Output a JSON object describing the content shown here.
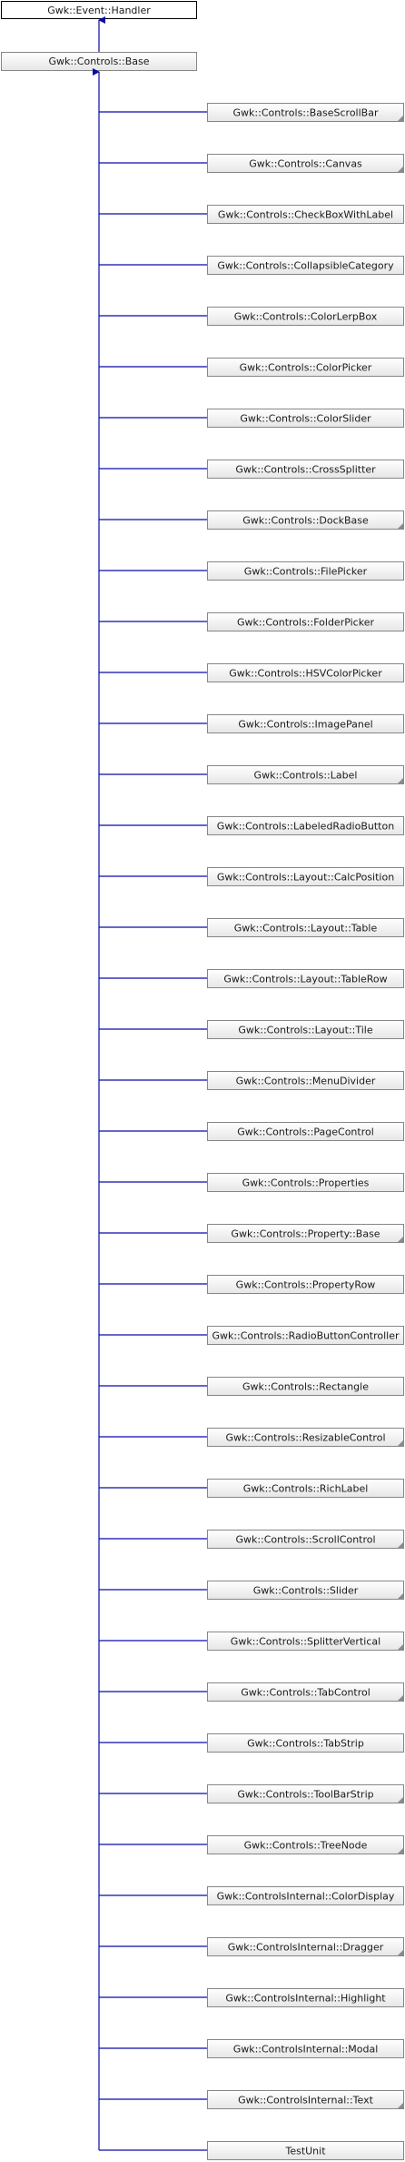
{
  "diagram": {
    "root": {
      "label": "Gwk::Event::Handler"
    },
    "base": {
      "label": "Gwk::Controls::Base"
    },
    "children": [
      "Gwk::Controls::BaseScrollBar",
      "Gwk::Controls::Canvas",
      "Gwk::Controls::CheckBoxWithLabel",
      "Gwk::Controls::CollapsibleCategory",
      "Gwk::Controls::ColorLerpBox",
      "Gwk::Controls::ColorPicker",
      "Gwk::Controls::ColorSlider",
      "Gwk::Controls::CrossSplitter",
      "Gwk::Controls::DockBase",
      "Gwk::Controls::FilePicker",
      "Gwk::Controls::FolderPicker",
      "Gwk::Controls::HSVColorPicker",
      "Gwk::Controls::ImagePanel",
      "Gwk::Controls::Label",
      "Gwk::Controls::LabeledRadioButton",
      "Gwk::Controls::Layout::CalcPosition",
      "Gwk::Controls::Layout::Table",
      "Gwk::Controls::Layout::TableRow",
      "Gwk::Controls::Layout::Tile",
      "Gwk::Controls::MenuDivider",
      "Gwk::Controls::PageControl",
      "Gwk::Controls::Properties",
      "Gwk::Controls::Property::Base",
      "Gwk::Controls::PropertyRow",
      "Gwk::Controls::RadioButtonController",
      "Gwk::Controls::Rectangle",
      "Gwk::Controls::ResizableControl",
      "Gwk::Controls::RichLabel",
      "Gwk::Controls::ScrollControl",
      "Gwk::Controls::Slider",
      "Gwk::Controls::SplitterVertical",
      "Gwk::Controls::TabControl",
      "Gwk::Controls::TabStrip",
      "Gwk::Controls::ToolBarStrip",
      "Gwk::Controls::TreeNode",
      "Gwk::ControlsInternal::ColorDisplay",
      "Gwk::ControlsInternal::Dragger",
      "Gwk::ControlsInternal::Highlight",
      "Gwk::ControlsInternal::Modal",
      "Gwk::ControlsInternal::Text",
      "TestUnit"
    ],
    "has_subclasses": [
      true,
      true,
      false,
      false,
      false,
      false,
      false,
      false,
      true,
      false,
      false,
      false,
      false,
      true,
      false,
      false,
      false,
      false,
      false,
      false,
      false,
      false,
      true,
      false,
      false,
      false,
      true,
      false,
      true,
      true,
      true,
      true,
      false,
      true,
      true,
      false,
      true,
      false,
      false,
      true,
      false
    ],
    "colors": {
      "link": "#0a0aa6",
      "box_border": "#868686",
      "root_border": "#000000"
    }
  }
}
